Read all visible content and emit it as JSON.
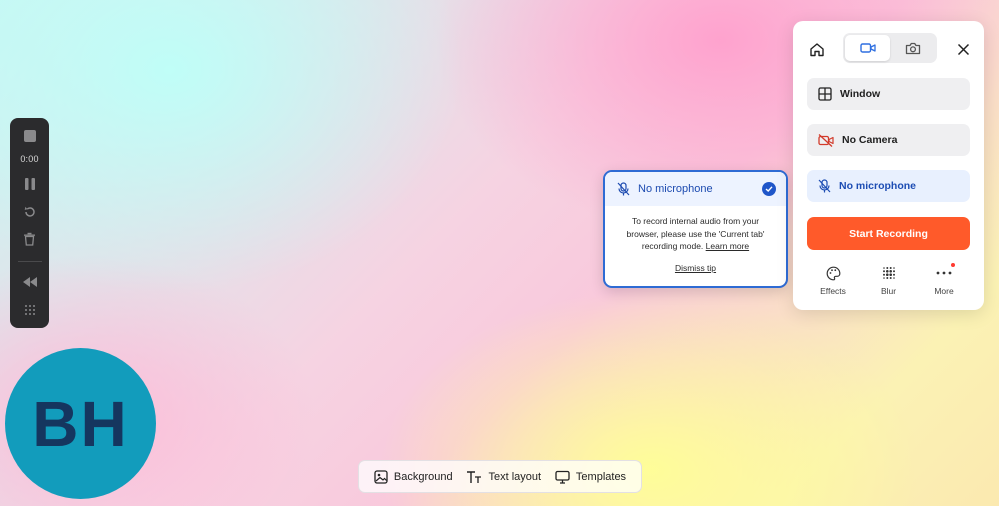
{
  "recorder_controls": {
    "timer": "0:00",
    "icons": [
      "stop-icon",
      "pause-icon",
      "restart-icon",
      "trash-icon",
      "rewind-icon",
      "grid-icon"
    ]
  },
  "avatar": {
    "initials": "BH",
    "color": "#129cbc"
  },
  "bottom_toolbar": {
    "background_label": "Background",
    "text_layout_label": "Text layout",
    "templates_label": "Templates"
  },
  "mic_tip": {
    "selected_label": "No microphone",
    "body_text": "To record internal audio from your browser, please use the 'Current tab' recording mode.",
    "learn_more": "Learn more",
    "dismiss": "Dismiss tip"
  },
  "panel": {
    "mode_tabs": [
      {
        "icon": "video-icon",
        "active": true
      },
      {
        "icon": "camera-icon",
        "active": false
      }
    ],
    "window_label": "Window",
    "camera_label": "No Camera",
    "microphone_label": "No microphone",
    "start_label": "Start Recording",
    "actions": {
      "effects": "Effects",
      "blur": "Blur",
      "more": "More"
    },
    "accent_color": "#ff5a2a",
    "selected_color": "#1c4cb3"
  }
}
